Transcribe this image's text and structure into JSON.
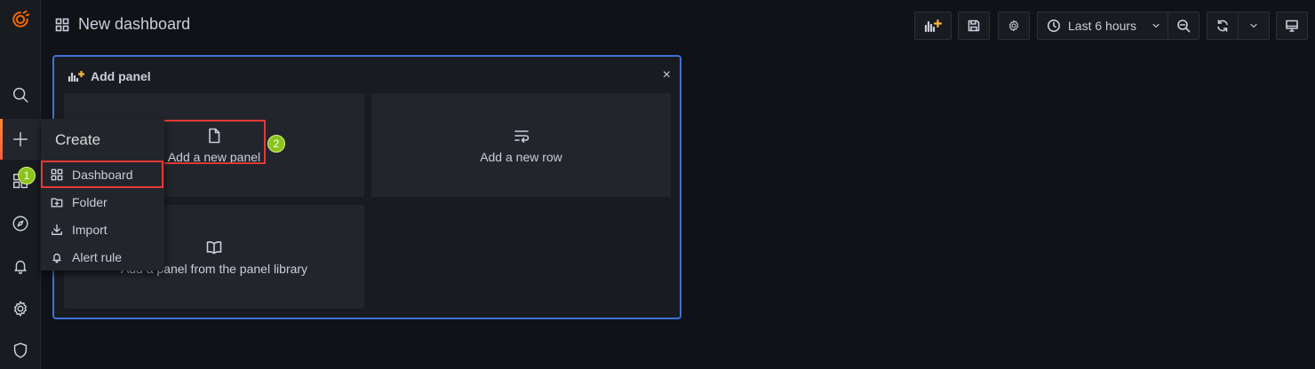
{
  "header": {
    "title": "New dashboard"
  },
  "toolbar": {
    "time_range_label": "Last 6 hours"
  },
  "add_panel": {
    "header_title": "Add panel",
    "close_glyph": "×",
    "options": {
      "new_panel": "Add a new panel",
      "new_row": "Add a new row",
      "from_library": "Add a panel from the panel library"
    }
  },
  "create_menu": {
    "title": "Create",
    "items": [
      {
        "label": "Dashboard",
        "icon": "apps-icon"
      },
      {
        "label": "Folder",
        "icon": "folder-plus-icon"
      },
      {
        "label": "Import",
        "icon": "import-icon"
      },
      {
        "label": "Alert rule",
        "icon": "bell-icon"
      }
    ]
  },
  "annotations": {
    "step1": "1",
    "step2": "2"
  },
  "colors": {
    "background": "#111217",
    "panel": "#181b1f",
    "tile": "#22252b",
    "accent_border": "#3d71d9",
    "highlight": "#e53935",
    "badge": "#8cc31c",
    "brand": "#f55f3e"
  }
}
